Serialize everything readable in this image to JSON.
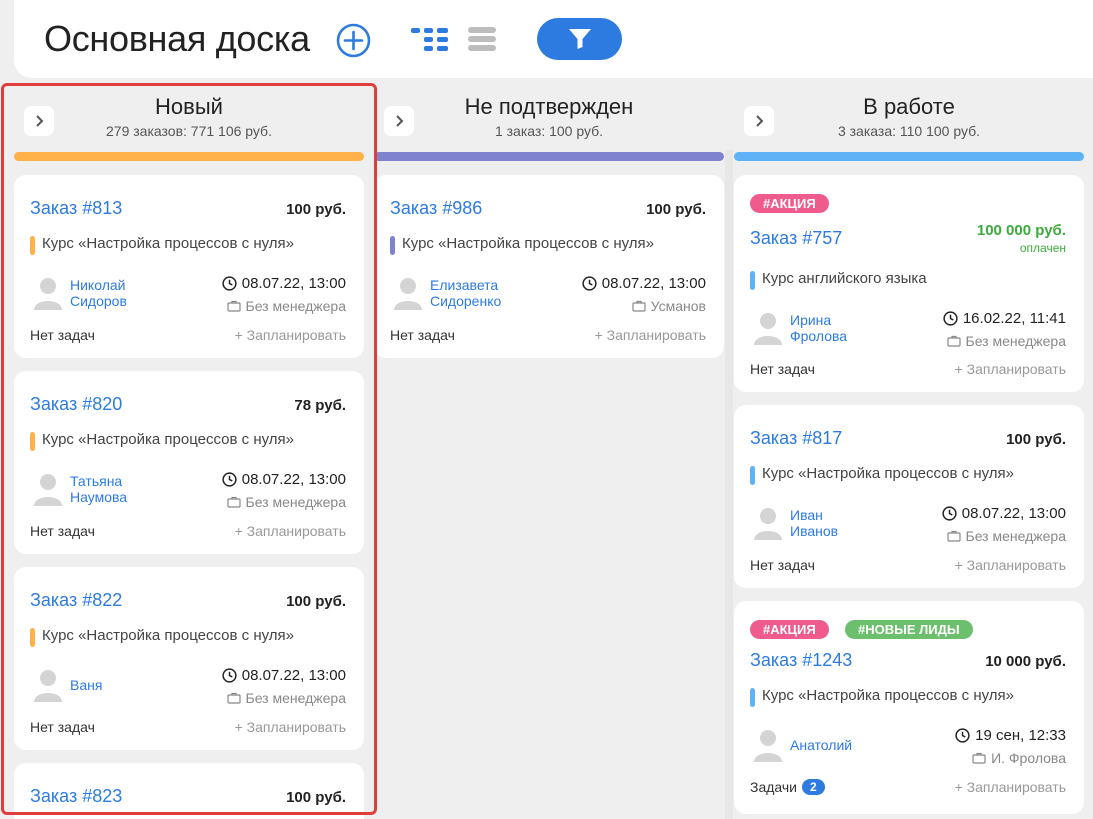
{
  "header": {
    "title": "Основная доска",
    "accent": "#2d7be0"
  },
  "icons": {
    "add": "plus-circle-icon",
    "kanban_view": "kanban-view-icon",
    "list_view": "list-view-icon",
    "filter": "filter-icon",
    "expand": "chevron-right-icon",
    "avatar": "user-avatar-icon",
    "clock": "clock-icon",
    "manager": "briefcase-icon"
  },
  "columns": [
    {
      "title": "Новый",
      "summary": "279 заказов: 771 106 руб.",
      "color": "#ffb24a",
      "cards": [
        {
          "order": "Заказ #813",
          "price": "100 руб.",
          "course": "Курс «Настройка процессов с нуля»",
          "course_color": "#ffb24a",
          "client_first": "Николай",
          "client_last": "Сидоров",
          "datetime": "08.07.22, 13:00",
          "manager": "Без менеджера",
          "tasks": "Нет задач",
          "plan": "+ Запланировать"
        },
        {
          "order": "Заказ #820",
          "price": "78 руб.",
          "course": "Курс «Настройка процессов с нуля»",
          "course_color": "#ffb24a",
          "client_first": "Татьяна",
          "client_last": "Наумова",
          "datetime": "08.07.22, 13:00",
          "manager": "Без менеджера",
          "tasks": "Нет задач",
          "plan": "+ Запланировать"
        },
        {
          "order": "Заказ #822",
          "price": "100 руб.",
          "course": "Курс «Настройка процессов с нуля»",
          "course_color": "#ffb24a",
          "client_first": "Ваня",
          "client_last": "",
          "datetime": "08.07.22, 13:00",
          "manager": "Без менеджера",
          "tasks": "Нет задач",
          "plan": "+ Запланировать"
        },
        {
          "order": "Заказ #823",
          "price": "100 руб."
        }
      ]
    },
    {
      "title": "Не подтвержден",
      "summary": "1 заказ: 100 руб.",
      "color": "#7f82cf",
      "cards": [
        {
          "order": "Заказ #986",
          "price": "100 руб.",
          "course": "Курс «Настройка процессов с нуля»",
          "course_color": "#7f82cf",
          "client_first": "Елизавета",
          "client_last": "Сидоренко",
          "datetime": "08.07.22, 13:00",
          "manager": "Усманов",
          "tasks": "Нет задач",
          "plan": "+ Запланировать"
        }
      ]
    },
    {
      "title": "В работе",
      "summary": "3 заказа: 110 100 руб.",
      "color": "#5fb2f5",
      "cards": [
        {
          "tags": [
            {
              "text": "#АКЦИЯ",
              "color": "#ef5b8c"
            }
          ],
          "order": "Заказ #757",
          "price": "100 000 руб.",
          "paid": "оплачен",
          "course": "Курс английского языка",
          "course_color": "#5fb2f5",
          "client_first": "Ирина",
          "client_last": "Фролова",
          "datetime": "16.02.22, 11:41",
          "manager": "Без менеджера",
          "tasks": "Нет задач",
          "plan": "+ Запланировать"
        },
        {
          "order": "Заказ #817",
          "price": "100 руб.",
          "course": "Курс «Настройка процессов с нуля»",
          "course_color": "#5fb2f5",
          "client_first": "Иван",
          "client_last": "Иванов",
          "datetime": "08.07.22, 13:00",
          "manager": "Без менеджера",
          "tasks": "Нет задач",
          "plan": "+ Запланировать"
        },
        {
          "tags": [
            {
              "text": "#АКЦИЯ",
              "color": "#ef5b8c"
            },
            {
              "text": "#НОВЫЕ ЛИДЫ",
              "color": "#6cbf6c"
            }
          ],
          "order": "Заказ #1243",
          "price": "10 000 руб.",
          "course": "Курс «Настройка процессов с нуля»",
          "course_color": "#5fb2f5",
          "client_first": "Анатолий",
          "client_last": "",
          "datetime": "19 сен, 12:33",
          "manager": "И. Фролова",
          "tasks": "Задачи",
          "tasks_count": "2",
          "plan": "+ Запланировать"
        }
      ]
    }
  ],
  "highlight_color": "#e03d3d"
}
